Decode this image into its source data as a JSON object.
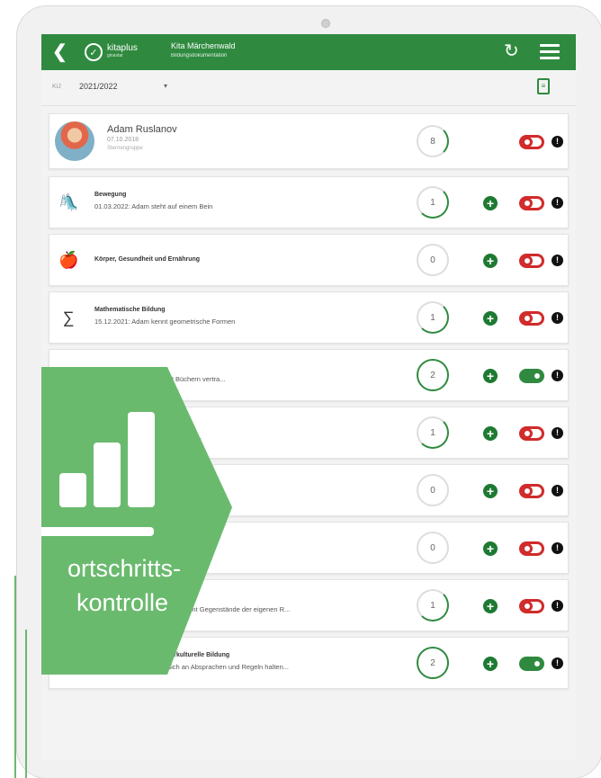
{
  "header": {
    "back_icon": "chevron-left-icon",
    "logo_name": "kitaplus",
    "logo_sub": "ginastar",
    "title": "Kita Märchenwald",
    "subtitle": "Bildungsdokumentation",
    "sync_icon": "sync-icon",
    "menu_icon": "hamburger-icon"
  },
  "filter": {
    "label": "KiJ",
    "year": "2021/2022",
    "export_icon": "export-document-icon"
  },
  "child": {
    "name": "Adam Ruslanov",
    "birthdate": "07.10.2018",
    "group": "Sternengruppe",
    "count": "8",
    "toggle": "off"
  },
  "categories": [
    {
      "icon": "climbing-frame-icon",
      "title": "Bewegung",
      "text": "01.03.2022: Adam steht auf einem Bein",
      "count": "1",
      "toggle": "off"
    },
    {
      "icon": "apple-icon",
      "title": "Körper, Gesundheit und Ernährung",
      "text": "",
      "count": "0",
      "toggle": "off"
    },
    {
      "icon": "math-operators-icon",
      "title": "Mathematische Bildung",
      "text": "15.12.2021: Adam kennt geometrische Formen",
      "count": "1",
      "toggle": "off"
    },
    {
      "icon": "book-icon",
      "title": "",
      "text": "uslanov ist im Umgang mit Büchern vertra...",
      "count": "2",
      "toggle": "on"
    },
    {
      "icon": "palette-icon",
      "title": "ng",
      "text": "erialien, die zum gestalterischen T...",
      "count": "1",
      "toggle": "off"
    },
    {
      "icon": "flask-icon",
      "title": "nische Bildung",
      "text": "",
      "count": "0",
      "toggle": "off"
    },
    {
      "icon": "music-icon",
      "title": "g",
      "text": "",
      "count": "0",
      "toggle": "off"
    },
    {
      "icon": "person-praying-icon",
      "title": "Religion und Ethik",
      "text": "29.03.2022: Adam Ruslanov kennt Gegenstände der eigenen R...",
      "count": "1",
      "toggle": "off"
    },
    {
      "icon": "speech-bubbles-icon",
      "title": "Soziale, kulturelle und interkulturelle Bildung",
      "text": "22.03.2022: Adam kann sich an Absprachen und Regeln halten...",
      "count": "2",
      "toggle": "on"
    }
  ],
  "overlay": {
    "icon": "bar-chart-icon",
    "line1": "ortschritts-",
    "line2": "kontrolle",
    "color": "#6aba6e"
  },
  "colors": {
    "brand_green": "#2f8a3f",
    "toggle_off": "#d12b2b"
  }
}
